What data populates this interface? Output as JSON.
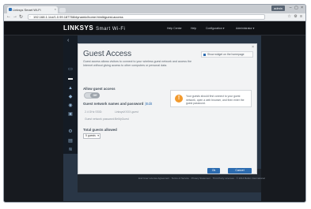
{
  "browser": {
    "tab_title": "Linksys Smart Wi-Fi",
    "tab_close": "×",
    "user_label": "admin",
    "window_buttons": "– ▢ ×",
    "url": "192.168.1.1/ui/1.0.99.187766/dynamic/home.html#guest-access",
    "nav": {
      "back": "←",
      "forward": "→",
      "reload": "↻"
    },
    "toolbar_right": "☆ ⚙ ≡"
  },
  "header": {
    "brand": "LINKSYS",
    "product": "Smart Wi-Fi",
    "nav": [
      "Help Center",
      "Help",
      "Configuration ▾",
      "Administrator ▾"
    ]
  },
  "sidebar": {
    "collapse": "‹",
    "icons": [
      "network-map-icon",
      "guest-access-icon",
      "parental-controls-icon",
      "media-prioritization-icon",
      "speed-test-icon",
      "usb-storage-icon",
      "connectivity-icon",
      "troubleshooting-icon",
      "wireless-icon",
      "security-icon"
    ]
  },
  "dialog": {
    "title": "Guest Access",
    "close": "×",
    "description": "Guest access allows visitors to connect to your wireless guest network and access the Internet without giving access to other computers or personal data.",
    "show_on_homepage_label": "Show widget on the homepage",
    "allow_label": "Allow guest access",
    "toggle_state": "Off",
    "network_header": "Guest network names and password",
    "edit_label": "Edit",
    "networks": [
      {
        "band": "2.4 GHz SSID:",
        "name": "LinksysXXXX-guest"
      },
      {
        "band": "Guest network password:",
        "name": "BeMyGuest"
      }
    ],
    "total_label": "Total guests allowed",
    "total_value": "5 guests",
    "warning_text": "Your guests should first connect to your guest network, open a web browser, and then enter the guest password.",
    "ok_label": "Ok",
    "cancel_label": "Cancel"
  },
  "footer": {
    "text": "End User License Agreement  ·  Terms of Service  ·  Privacy Statement  ·  Third Party Licenses  ·  © 2014 Belkin International"
  }
}
